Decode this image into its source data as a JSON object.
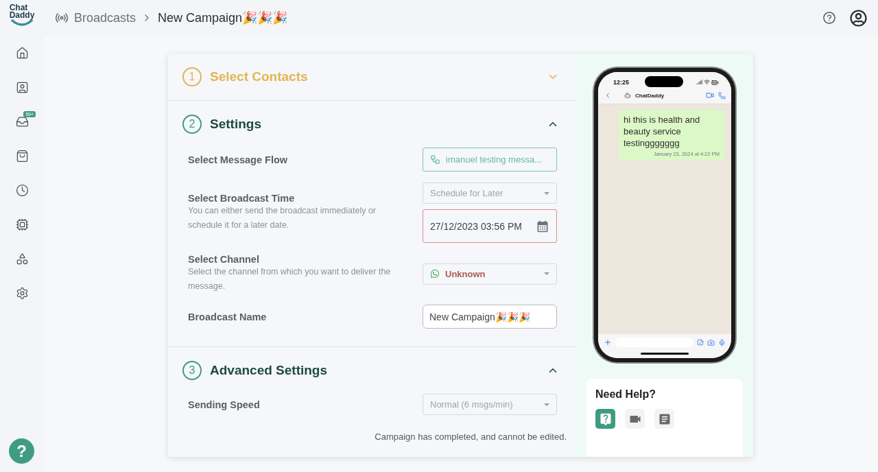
{
  "logo": {
    "lines": [
      "Chat",
      "Daddy"
    ]
  },
  "breadcrumb": [
    {
      "label": "Broadcasts"
    },
    {
      "label": "New Campaign🎉🎉🎉"
    }
  ],
  "sidebar": {
    "items": [
      {
        "kind": "home"
      },
      {
        "kind": "contacts"
      },
      {
        "kind": "inbox",
        "badge": "99+"
      },
      {
        "kind": "shop"
      },
      {
        "kind": "history"
      },
      {
        "kind": "ai"
      },
      {
        "kind": "apps"
      },
      {
        "kind": "settings"
      }
    ]
  },
  "help_fab": "?",
  "sections": [
    {
      "number": "1",
      "title": "Select Contacts",
      "color": "#e2b650",
      "expanded": false
    },
    {
      "number": "2",
      "title": "Settings",
      "color": "#3f9c82",
      "expanded": true,
      "fields": [
        {
          "kind": "flow",
          "label": "Select Message Flow",
          "value": "imanuel testing messa..."
        },
        {
          "kind": "select",
          "label": "Select Broadcast Time",
          "description": "You can either send the broadcast immediately or schedule it for a later date.",
          "value": "Schedule for Later",
          "disabled": true,
          "extra": {
            "kind": "datetime",
            "value": "27/12/2023 03:56 PM",
            "error": true
          }
        },
        {
          "kind": "channel",
          "label": "Select Channel",
          "description": "Select the channel from which you want to deliver the message.",
          "value": "Unknown"
        },
        {
          "kind": "text",
          "label": "Broadcast Name",
          "value": "New Campaign🎉🎉🎉"
        }
      ]
    },
    {
      "number": "3",
      "title": "Advanced Settings",
      "color": "#3f9c82",
      "expanded": true,
      "fields": [
        {
          "kind": "select",
          "label": "Sending Speed",
          "value": "Normal (6 msgs/min)",
          "disabled": true
        }
      ]
    }
  ],
  "footer_note": "Campaign has completed, and cannot be edited.",
  "preview": {
    "time": "12:25",
    "contact": "ChatDaddy",
    "message": "hi this is health and beauty service testinggggggg",
    "timestamp": "January 23, 2024 at 4:22 PM"
  },
  "help": {
    "title": "Need Help?",
    "buttons": [
      {
        "kind": "faq",
        "selected": true
      },
      {
        "kind": "video",
        "selected": false
      },
      {
        "kind": "doc",
        "selected": false
      }
    ]
  }
}
